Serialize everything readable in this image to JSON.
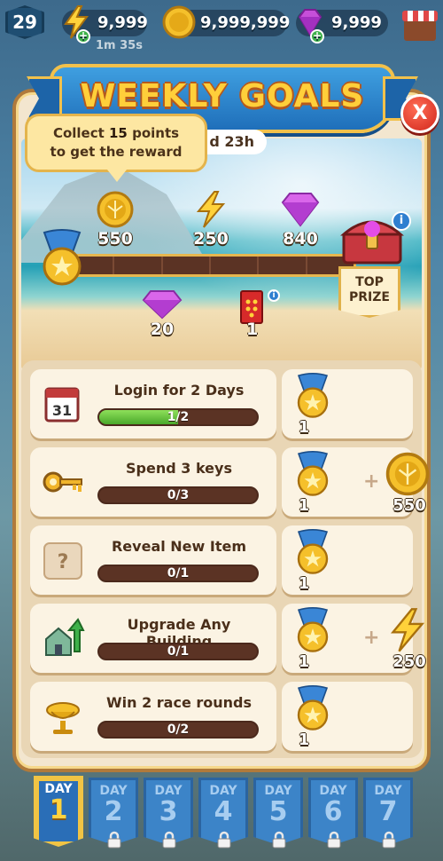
{
  "resources": {
    "level": "29",
    "energy": "9,999",
    "coins": "9,999,999",
    "gems": "9,999",
    "timer": "1m 35s"
  },
  "dialog": {
    "title": "WEEKLY GOALS",
    "close_label": "X",
    "timer": "d 23h",
    "tooltip_prefix": "Collect ",
    "tooltip_points": "15",
    "tooltip_mid": " points",
    "tooltip_line2": "to get the reward",
    "top_prize_line1": "TOP",
    "top_prize_line2": "PRIZE",
    "info": "i"
  },
  "milestones": {
    "top": [
      {
        "type": "coin",
        "amount": "550"
      },
      {
        "type": "energy",
        "amount": "250"
      },
      {
        "type": "gem",
        "amount": "840"
      }
    ],
    "bottom": [
      {
        "type": "gem",
        "amount": "20"
      },
      {
        "type": "card",
        "amount": "1"
      }
    ]
  },
  "tasks": [
    {
      "title": "Login for 2 Days",
      "progress": "1/2",
      "fraction": 0.5,
      "rewards": [
        {
          "type": "medal",
          "amount": "1"
        }
      ]
    },
    {
      "title": "Spend 3 keys",
      "progress": "0/3",
      "fraction": 0,
      "rewards": [
        {
          "type": "medal",
          "amount": "1"
        },
        {
          "type": "coin",
          "amount": "550"
        }
      ]
    },
    {
      "title": "Reveal New Item",
      "progress": "0/1",
      "fraction": 0,
      "rewards": [
        {
          "type": "medal",
          "amount": "1"
        }
      ]
    },
    {
      "title": "Upgrade Any Building",
      "progress": "0/1",
      "fraction": 0,
      "rewards": [
        {
          "type": "medal",
          "amount": "1"
        },
        {
          "type": "energy",
          "amount": "250"
        }
      ]
    },
    {
      "title": "Win 2 race rounds",
      "progress": "0/2",
      "fraction": 0,
      "rewards": [
        {
          "type": "medal",
          "amount": "1"
        }
      ]
    }
  ],
  "plus_sign": "+",
  "days": [
    {
      "label": "DAY",
      "num": "1",
      "active": true,
      "locked": false
    },
    {
      "label": "DAY",
      "num": "2",
      "active": false,
      "locked": true
    },
    {
      "label": "DAY",
      "num": "3",
      "active": false,
      "locked": true
    },
    {
      "label": "DAY",
      "num": "4",
      "active": false,
      "locked": true
    },
    {
      "label": "DAY",
      "num": "5",
      "active": false,
      "locked": true
    },
    {
      "label": "DAY",
      "num": "6",
      "active": false,
      "locked": true
    },
    {
      "label": "DAY",
      "num": "7",
      "active": false,
      "locked": true
    }
  ],
  "colors": {
    "progress_fill": "#5fbf35",
    "track": "#5b3324",
    "banner": "#2a7fcf",
    "title": "#ffcf3a"
  }
}
